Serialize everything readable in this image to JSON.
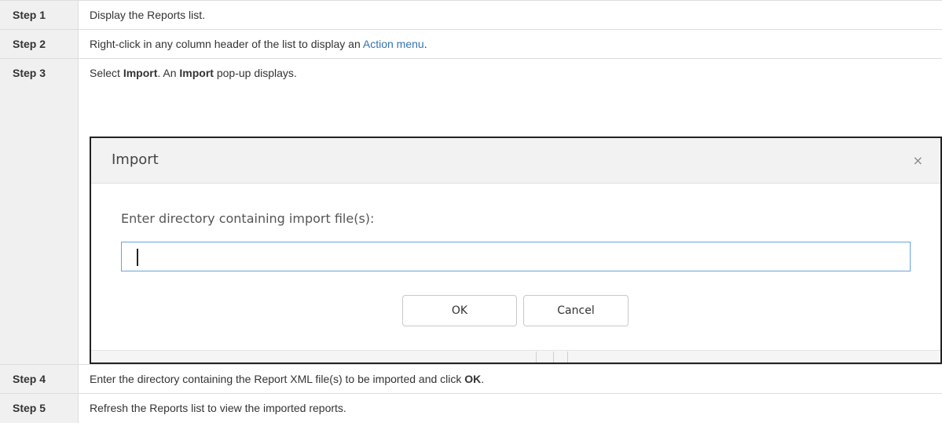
{
  "steps": [
    {
      "label": "Step 1",
      "text": "Display the Reports list."
    },
    {
      "label": "Step 2",
      "text_before": "Right-click in any column header of the list to display an ",
      "link": "Action menu",
      "text_after": "."
    },
    {
      "label": "Step 3",
      "text_1": "Select ",
      "bold_1": "Import",
      "text_2": ". An ",
      "bold_2": "Import",
      "text_3": " pop-up displays."
    },
    {
      "label": "Step 4",
      "text_before": "Enter the directory containing the Report XML file(s) to be imported and click ",
      "bold": "OK",
      "text_after": "."
    },
    {
      "label": "Step 5",
      "text": "Refresh the Reports list to view the imported reports."
    }
  ],
  "dialog": {
    "title": "Import",
    "close": "×",
    "label": "Enter directory containing import file(s):",
    "input_value": "",
    "ok": "OK",
    "cancel": "Cancel"
  },
  "colors": {
    "link": "#3572b0",
    "header_bg": "#f0f0f0",
    "input_border": "#66a3e0"
  }
}
